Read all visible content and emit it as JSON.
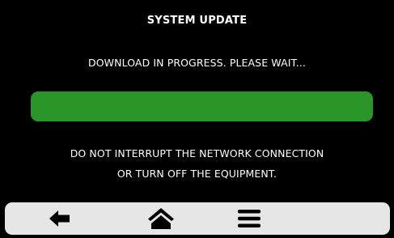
{
  "dialog": {
    "title": "SYSTEM UPDATE",
    "status_text": "DOWNLOAD IN PROGRESS. PLEASE WAIT...",
    "progress_fraction": 1.0,
    "warning_line_1": "DO NOT INTERRUPT THE NETWORK CONNECTION",
    "warning_line_2": "OR TURN OFF THE EQUIPMENT."
  },
  "navbar": {
    "buttons": [
      {
        "icon": "back-arrow-icon"
      },
      {
        "icon": "home-icon"
      },
      {
        "icon": "menu-icon"
      }
    ]
  },
  "colors": {
    "background": "#000000",
    "text": "#ffffff",
    "progress_fill": "#2a962a",
    "navbar_background": "#e6e6e6",
    "icon": "#000000"
  }
}
